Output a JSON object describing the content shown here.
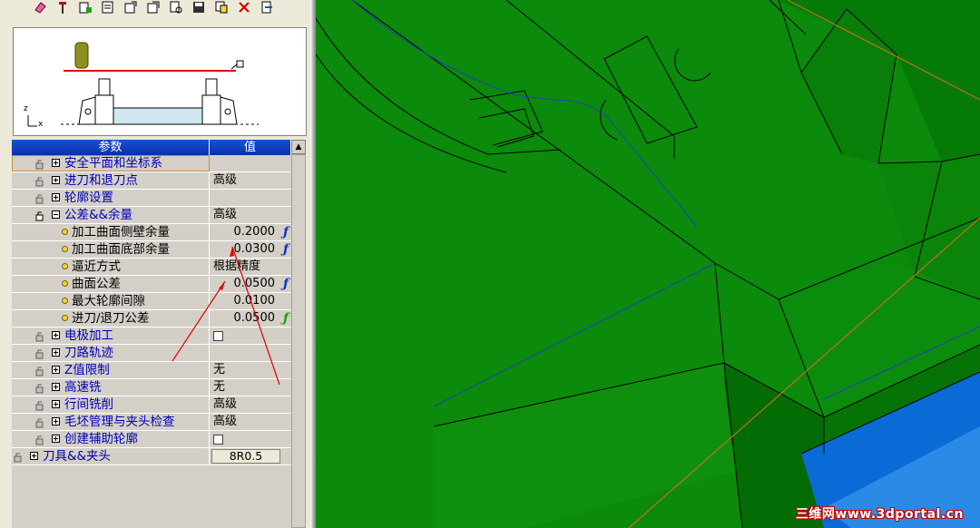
{
  "toolbar": {
    "icons": [
      "eraser-icon",
      "pin-icon",
      "tool-add-icon",
      "tool-list-icon",
      "export-icon",
      "import-icon",
      "search-icon",
      "save-icon",
      "copy-icon",
      "delete-tool-icon",
      "exit-icon"
    ]
  },
  "preview": {
    "axis_z": "z",
    "axis_x": "x"
  },
  "param_table": {
    "header_name": "参数",
    "header_value": "值",
    "rows": [
      {
        "type": "group",
        "label": "安全平面和坐标系",
        "value": "",
        "expanded": false,
        "selected": true
      },
      {
        "type": "group",
        "label": "进刀和退刀点",
        "value": "高级",
        "expanded": false
      },
      {
        "type": "group",
        "label": "轮廓设置",
        "value": "",
        "expanded": false
      },
      {
        "type": "group",
        "label": "公差&&余量",
        "value": "高级",
        "expanded": true
      },
      {
        "type": "item",
        "label": "加工曲面侧壁余量",
        "value": "0.2000",
        "fx": "blue"
      },
      {
        "type": "item",
        "label": "加工曲面底部余量",
        "value": "0.0300",
        "fx": "blue"
      },
      {
        "type": "item",
        "label": "逼近方式",
        "value": "根据精度",
        "fx": ""
      },
      {
        "type": "item",
        "label": "曲面公差",
        "value": "0.0500",
        "fx": "blue"
      },
      {
        "type": "item",
        "label": "最大轮廓间隙",
        "value": "0.0100",
        "fx": ""
      },
      {
        "type": "item",
        "label": "进刀/退刀公差",
        "value": "0.0500",
        "fx": "green"
      },
      {
        "type": "group",
        "label": "电极加工",
        "value": "",
        "checkbox": true
      },
      {
        "type": "group",
        "label": "刀路轨迹",
        "value": ""
      },
      {
        "type": "group",
        "label": "Z值限制",
        "value": "无"
      },
      {
        "type": "group",
        "label": "高速铣",
        "value": "无"
      },
      {
        "type": "group",
        "label": "行间铣削",
        "value": "高级"
      },
      {
        "type": "group",
        "label": "毛坯管理与夹头检查",
        "value": "高级"
      },
      {
        "type": "group",
        "label": "创建辅助轮廓",
        "value": "",
        "checkbox": true
      },
      {
        "type": "top",
        "label": "刀具&&夹头",
        "value": "8R0.5",
        "button": true
      }
    ],
    "fx_symbol": "ƒ"
  },
  "colors": {
    "model_green": "#0b8a0b",
    "edge_black": "#000000",
    "toolpath_blue": "#2040c0",
    "table_blue": "#0000b0",
    "annotation_red": "#e00000",
    "water_blue": "#0a6ad6"
  },
  "watermark": "三维网www.3dportal.cn"
}
